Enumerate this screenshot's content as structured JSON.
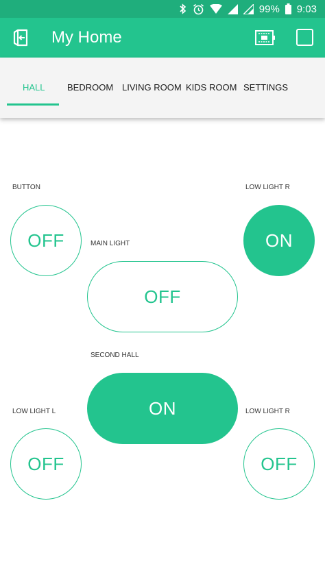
{
  "status_bar": {
    "battery": "99%",
    "time": "9:03"
  },
  "app_bar": {
    "title": "My Home"
  },
  "tabs": [
    {
      "label": "HALL",
      "active": true
    },
    {
      "label": "BEDROOM",
      "active": false
    },
    {
      "label": "LIVING ROOM",
      "active": false
    },
    {
      "label": "KIDS ROOM",
      "active": false
    },
    {
      "label": "SETTINGS",
      "active": false
    }
  ],
  "widgets": {
    "button": {
      "label": "BUTTON",
      "state": "OFF"
    },
    "low_light_r_top": {
      "label": "LOW LIGHT R",
      "state": "ON"
    },
    "main_light": {
      "label": "MAIN LIGHT",
      "state": "OFF"
    },
    "second_hall": {
      "label": "SECOND HALL",
      "state": "ON"
    },
    "low_light_l": {
      "label": "LOW LIGHT L",
      "state": "OFF"
    },
    "low_light_r_bottom": {
      "label": "LOW LIGHT R",
      "state": "OFF"
    }
  },
  "colors": {
    "accent": "#23c48e",
    "status_bar": "#1fae7c",
    "tab_bar": "#f4f4f4"
  }
}
